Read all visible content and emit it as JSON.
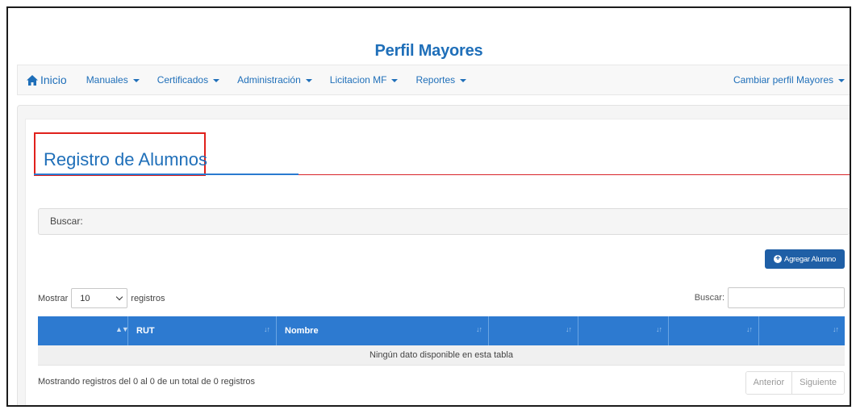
{
  "header": {
    "title": "Perfil Mayores"
  },
  "nav": {
    "home": "Inicio",
    "items": [
      "Manuales",
      "Certificados",
      "Administración",
      "Licitacion MF",
      "Reportes"
    ],
    "right": "Cambiar perfil Mayores"
  },
  "page": {
    "title": "Registro de Alumnos",
    "search_label": "Buscar:",
    "add_button": "Agregar Alumno"
  },
  "table": {
    "length_prefix": "Mostrar",
    "length_value": "10",
    "length_suffix": "registros",
    "filter_label": "Buscar:",
    "columns": [
      "RUT",
      "Nombre",
      "",
      "",
      "",
      "",
      ""
    ],
    "empty_message": "Ningún dato disponible en esta tabla",
    "info": "Mostrando registros del 0 al 0 de un total de 0 registros",
    "prev": "Anterior",
    "next": "Siguiente"
  },
  "colors": {
    "primary": "#1f6fb9",
    "table_header": "#2d7ad0",
    "button": "#1f5fa6",
    "highlight": "#e0211c"
  }
}
